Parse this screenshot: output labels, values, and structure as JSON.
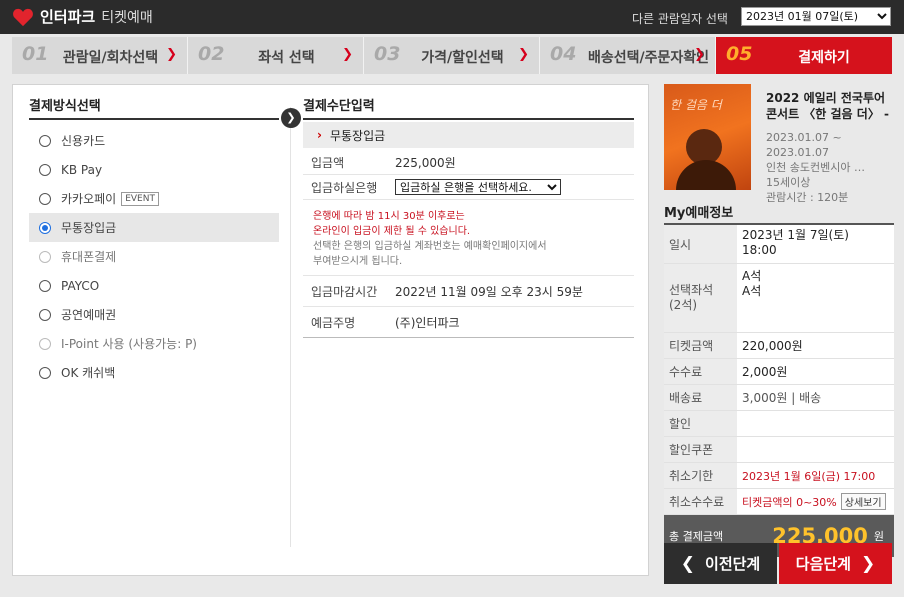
{
  "header": {
    "brand": "인터파크",
    "subtitle": "티켓예매",
    "date_label": "다른 관람일자 선택",
    "date_value": "2023년 01월 07일(토)"
  },
  "steps": [
    {
      "num": "01",
      "label": "관람일/회차선택"
    },
    {
      "num": "02",
      "label": "좌석 선택"
    },
    {
      "num": "03",
      "label": "가격/할인선택"
    },
    {
      "num": "04",
      "label": "배송선택/주문자확인"
    },
    {
      "num": "05",
      "label": "결제하기"
    }
  ],
  "left_panel": {
    "title": "결제방식선택",
    "options": [
      {
        "label": "신용카드",
        "state": "enabled"
      },
      {
        "label": "KB Pay",
        "state": "enabled"
      },
      {
        "label": "카카오페이",
        "badge": "EVENT",
        "state": "enabled"
      },
      {
        "label": "무통장입금",
        "state": "selected"
      },
      {
        "label": "휴대폰결제",
        "state": "disabled"
      },
      {
        "label": "PAYCO",
        "state": "enabled"
      },
      {
        "label": "공연예매권",
        "state": "enabled"
      },
      {
        "label": "I-Point 사용 (사용가능: P)",
        "state": "disabled"
      },
      {
        "label": "OK 캐쉬백",
        "state": "enabled"
      }
    ]
  },
  "right_panel": {
    "title": "결제수단입력",
    "sub_title": "무통장입금",
    "amount_label": "입금액",
    "amount_value": "225,000원",
    "bank_label": "입금하실은행",
    "bank_placeholder": "입금하실 은행을 선택하세요.",
    "notice_red_1": "은행에 따라 밤 11시 30분 이후로는",
    "notice_red_2": "온라인이 입금이 제한 될 수 있습니다.",
    "notice_gray_1": "선택한 은행의 입금하실 계좌번호는 예매확인페이지에서",
    "notice_gray_2": "부여받으시게 됩니다.",
    "deadline_label": "입금마감시간",
    "deadline_value": "2022년 11월 09일 오후 23시 59분",
    "holder_label": "예금주명",
    "holder_value": "(주)인터파크"
  },
  "show": {
    "poster_text": "한 걸음 더",
    "title_line1": "2022 에일리 전국투어",
    "title_line2": "콘서트 〈한 걸음 더〉 - 인",
    "period_start": "2023.01.07 ~",
    "period_end": "2023.01.07",
    "venue": "인천 송도컨벤시아 …",
    "age": "15세이상",
    "runtime": "관람시간 : 120분"
  },
  "my_booking": {
    "title": "My예매정보",
    "date_label": "일시",
    "date_value": "2023년 1월 7일(토)",
    "time_value": "18:00",
    "seats_label": "선택좌석",
    "seats_count": "(2석)",
    "seats": [
      "A석",
      "A석"
    ],
    "ticket_label": "티켓금액",
    "ticket_value": "220,000원",
    "fee_label": "수수료",
    "fee_value": "2,000원",
    "delivery_label": "배송료",
    "delivery_value": "3,000원 | 배송",
    "discount_label": "할인",
    "discount_value": "",
    "coupon_label": "할인쿠폰",
    "coupon_value": "",
    "cancel_deadline_label": "취소기한",
    "cancel_deadline_value": "2023년 1월 6일(금) 17:00",
    "cancel_fee_label": "취소수수료",
    "cancel_fee_value": "티켓금액의 0~30%",
    "detail_button": "상세보기",
    "total_label": "총 결제금액",
    "total_amount": "225,000",
    "total_unit": "원"
  },
  "buttons": {
    "prev": "이전단계",
    "next": "다음단계"
  },
  "colors": {
    "accent_red": "#d5121c",
    "total_yellow": "#ffc22b",
    "header_dark": "#2b2b2b"
  }
}
